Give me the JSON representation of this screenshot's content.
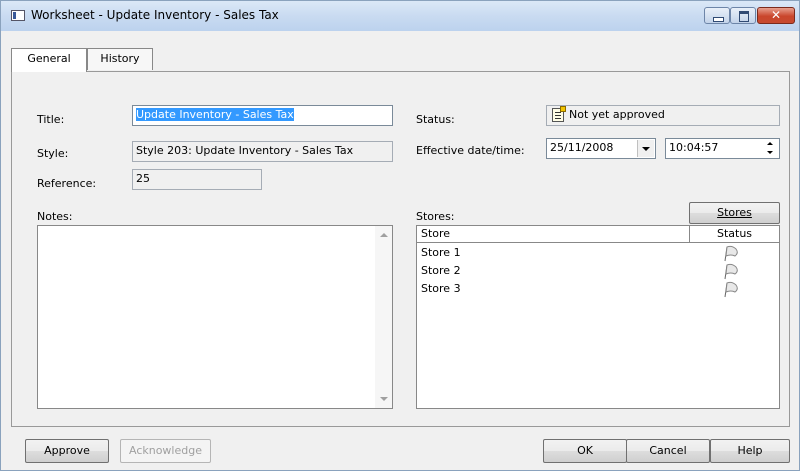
{
  "window": {
    "title": "Worksheet - Update Inventory - Sales Tax",
    "close_glyph": "✕"
  },
  "tabs": [
    {
      "label": "General"
    },
    {
      "label": "History"
    }
  ],
  "form": {
    "title_label": "Title:",
    "title_value": "Update Inventory - Sales Tax",
    "style_label": "Style:",
    "style_value": "Style 203: Update Inventory - Sales Tax",
    "reference_label": "Reference:",
    "reference_value": "25",
    "notes_label": "Notes:",
    "status_label": "Status:",
    "status_value": "Not yet approved",
    "effective_label": "Effective date/time:",
    "date_value": "25/11/2008",
    "time_value": "10:04:57",
    "stores_label": "Stores:",
    "stores_button": "Stores"
  },
  "stores_table": {
    "columns": [
      "Store",
      "Status"
    ],
    "rows": [
      {
        "name": "Store 1",
        "status_icon": "flag-icon"
      },
      {
        "name": "Store 2",
        "status_icon": "flag-icon"
      },
      {
        "name": "Store 3",
        "status_icon": "flag-icon"
      }
    ]
  },
  "footer": {
    "approve": "Approve",
    "acknowledge": "Acknowledge",
    "ok": "OK",
    "cancel": "Cancel",
    "help": "Help"
  }
}
